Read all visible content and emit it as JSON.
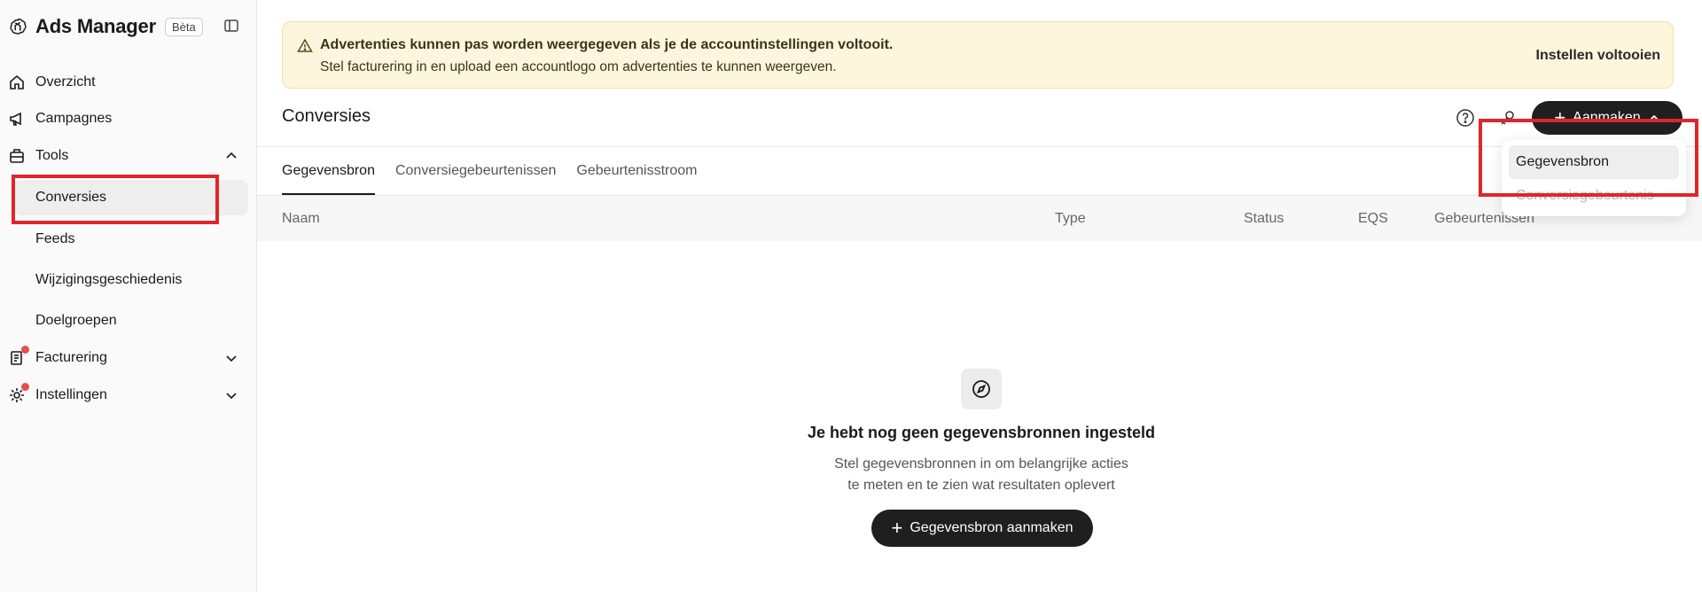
{
  "app": {
    "title": "Ads Manager",
    "badge": "Bèta"
  },
  "sidebar": {
    "items": [
      {
        "label": "Overzicht",
        "icon": "home-icon"
      },
      {
        "label": "Campagnes",
        "icon": "megaphone-icon"
      },
      {
        "label": "Tools",
        "icon": "toolbox-icon",
        "expanded": true
      },
      {
        "label": "Facturering",
        "icon": "invoice-icon",
        "notification": true
      },
      {
        "label": "Instellingen",
        "icon": "gear-icon",
        "notification": true
      }
    ],
    "tools_sub": [
      {
        "label": "Conversies",
        "active": true
      },
      {
        "label": "Feeds"
      },
      {
        "label": "Wijzigingsgeschiedenis"
      },
      {
        "label": "Doelgroepen"
      }
    ]
  },
  "banner": {
    "title": "Advertenties kunnen pas worden weergegeven als je de accountinstellingen voltooit.",
    "text": "Stel facturering in en upload een accountlogo om advertenties te kunnen weergeven.",
    "action": "Instellen voltooien"
  },
  "page": {
    "title": "Conversies",
    "create_label": "Aanmaken"
  },
  "tabs": [
    {
      "label": "Gegevensbron",
      "active": true
    },
    {
      "label": "Conversiegebeurtenissen"
    },
    {
      "label": "Gebeurtenisstroom"
    }
  ],
  "table": {
    "columns": [
      "Naam",
      "Type",
      "Status",
      "EQS",
      "Gebeurtenissen"
    ]
  },
  "empty": {
    "title": "Je hebt nog geen gegevensbronnen ingesteld",
    "line1": "Stel gegevensbronnen in om belangrijke acties",
    "line2": "te meten en te zien wat resultaten oplevert",
    "button": "Gegevensbron aanmaken"
  },
  "dropdown": {
    "items": [
      "Gegevensbron",
      "Conversiegebeurtenis"
    ]
  },
  "colors": {
    "highlight": "#e0262a",
    "banner_bg": "#fdf6dc",
    "primary_button": "#1f1f1f",
    "notification_dot": "#e0524b"
  }
}
